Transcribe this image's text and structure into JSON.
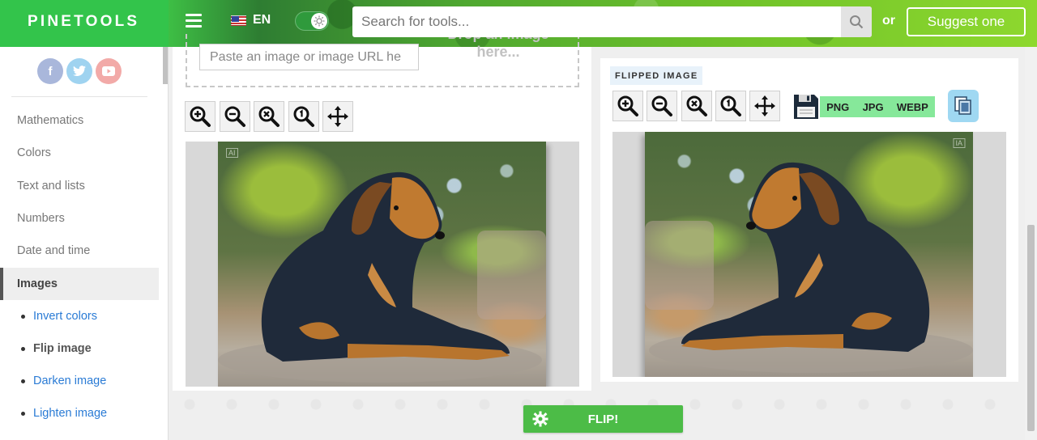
{
  "header": {
    "logo": "PINETOOLS",
    "language": "EN",
    "search_placeholder": "Search for tools...",
    "or_label": "or",
    "suggest_label": "Suggest one"
  },
  "sidebar": {
    "social": [
      "f",
      "t",
      "yt"
    ],
    "categories": [
      "Mathematics",
      "Colors",
      "Text and lists",
      "Numbers",
      "Date and time",
      "Images"
    ],
    "active_category": "Images",
    "subitems": [
      "Invert colors",
      "Flip image",
      "Darken image",
      "Lighten image"
    ],
    "current_subitem": "Flip image"
  },
  "input": {
    "url_placeholder": "Paste an image or image URL he",
    "drop_line1": "Drop an image",
    "drop_line2": "here..."
  },
  "output": {
    "label": "FLIPPED IMAGE",
    "formats": [
      "PNG",
      "JPG",
      "WEBP"
    ]
  },
  "image_badge": "AI",
  "image_badge_flipped": "IA",
  "actions": {
    "flip_label": "FLIP!"
  },
  "colors": {
    "brand_green": "#33c44b",
    "flip_button": "#4cbc47",
    "format_bar": "#86e89a",
    "link_blue": "#2a7bd5"
  }
}
